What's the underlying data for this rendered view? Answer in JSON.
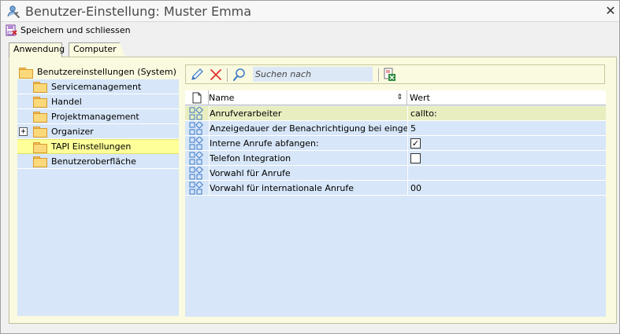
{
  "window": {
    "title": "Benutzer-Einstellung: Muster Emma",
    "close_glyph": "✕"
  },
  "toolbar": {
    "save_label": "Speichern und schliessen"
  },
  "tabs": [
    {
      "label": "Anwendung",
      "active": true
    },
    {
      "label": "Computer",
      "active": false
    }
  ],
  "tree": {
    "root_label": "Benutzereinstellungen (System)",
    "items": [
      {
        "label": "Servicemanagement",
        "expandable": false,
        "selected": false
      },
      {
        "label": "Handel",
        "expandable": false,
        "selected": false
      },
      {
        "label": "Projektmanagement",
        "expandable": false,
        "selected": false
      },
      {
        "label": "Organizer",
        "expandable": true,
        "expander_glyph": "+",
        "selected": false
      },
      {
        "label": "TAPI Einstellungen",
        "expandable": false,
        "selected": true
      },
      {
        "label": "Benutzeroberfläche",
        "expandable": false,
        "selected": false
      }
    ]
  },
  "grid_toolbar": {
    "search_placeholder": "Suchen nach",
    "icons": [
      "edit-pencil-icon",
      "delete-x-icon",
      "search-magnifier-icon",
      "excel-export-icon"
    ]
  },
  "grid": {
    "columns": [
      "Name",
      "Wert"
    ],
    "rows": [
      {
        "name": "Anrufverarbeiter",
        "value": "callto:",
        "type": "text",
        "highlighted": true
      },
      {
        "name": "Anzeigedauer der Benachrichtigung bei eingehe...",
        "value": "5",
        "type": "text",
        "highlighted": false
      },
      {
        "name": "Interne Anrufe abfangen:",
        "value": "✓",
        "type": "checkbox",
        "checked": true,
        "highlighted": false
      },
      {
        "name": "Telefon Integration",
        "value": "",
        "type": "checkbox",
        "checked": false,
        "highlighted": false
      },
      {
        "name": "Vorwahl für Anrufe",
        "value": "",
        "type": "text",
        "highlighted": false
      },
      {
        "name": "Vorwahl für internationale Anrufe",
        "value": "00",
        "type": "text",
        "highlighted": false
      }
    ]
  },
  "colors": {
    "panel_bg": "#fafae0",
    "list_bg": "#d7e6f8",
    "selected_bg": "#ffff99",
    "row_highlight": "#e8eec0",
    "delete_red": "#e03030"
  }
}
